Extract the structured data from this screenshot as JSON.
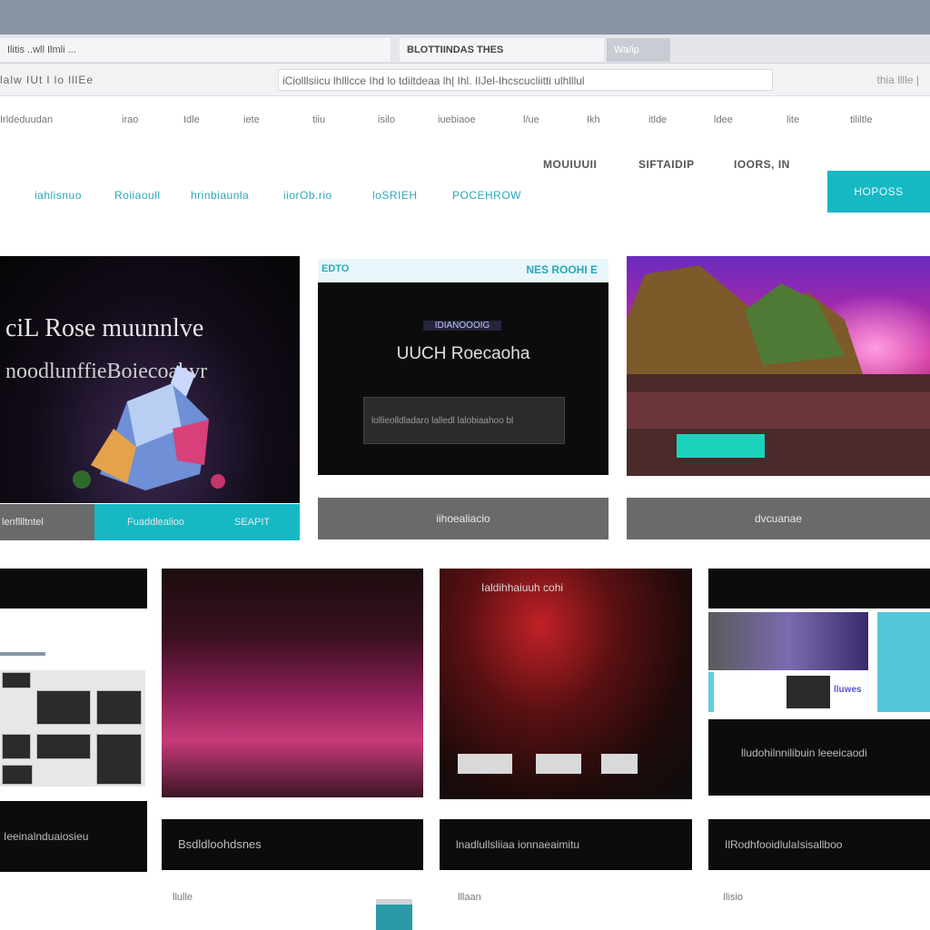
{
  "browser": {
    "tabs": [
      "Ilitis ..wll Ilmli ...",
      "BLOTTIINDAS THES",
      "Wa/ip"
    ],
    "address_prefix": "lalw IUt l lo  lllEe",
    "address_url": "iCiolllsiicu lhlllcce  Ihd lo  tdiltdeaa lh|  Ihl. IIJel-Ihcscucliitti ulhlllul",
    "address_suffix": "thia lllle  |"
  },
  "bookmarks": [
    "Irldeduudan",
    "irao",
    "Idle",
    "iete",
    "tiiu",
    "isilo",
    "iuebiaoe",
    "l/ue",
    "Ikh",
    "itlde",
    "ldee",
    "lite",
    "tililtle"
  ],
  "header": {
    "util_links": [
      "MOUIUUII",
      "SIFTAIDIP",
      "IOORS, IN"
    ],
    "nav_links": [
      "iahlisnuo",
      "Roiiaoull",
      "hrinbiaunla",
      "iiorOb.rio",
      "loSRIEH",
      "POCEHROW"
    ],
    "cta_label": "HOPOSS"
  },
  "hero_cards": [
    {
      "title": "ciL Rose muunnlve",
      "subtitle": "noodlunffieBoiecoahvr",
      "strip_left": "lenfllltntel",
      "strip_mid": "Fuaddlealioo",
      "strip_right": "SEAPIT"
    },
    {
      "banner_left": "EDTO",
      "banner_right": "NES ROOHI E",
      "kicker": "IDIANOOOIG",
      "title": "UUCH Roecaoha",
      "search_text": "lollieolldladaro  lalledl lalobiaahoo bl",
      "strip": "iihoealiacio"
    },
    {
      "strip": "dvcuanae"
    }
  ],
  "grid": {
    "left_top": "",
    "left_bottom": "Ieeinalnduaiosieu",
    "pink_bottom": "Bsdldloohdsnes",
    "red_caption": "Ialdihhaiuuh cohi",
    "red_bottom": "lnadlullsliiaa ionnaeaimitu",
    "right_mini_label": "lluwes",
    "right_mid": "lludohilnnilibuin leeeicaodi",
    "right_bottom": "IlRodhfooidlulaIsisallboo"
  },
  "footer": [
    "llulle",
    "lllaan",
    "Ilisio"
  ],
  "colors": {
    "accent": "#16b8c4",
    "teal_button": "#1ad3bd",
    "dark": "#0c0c0c",
    "gray_strip": "#6a6a6a"
  }
}
